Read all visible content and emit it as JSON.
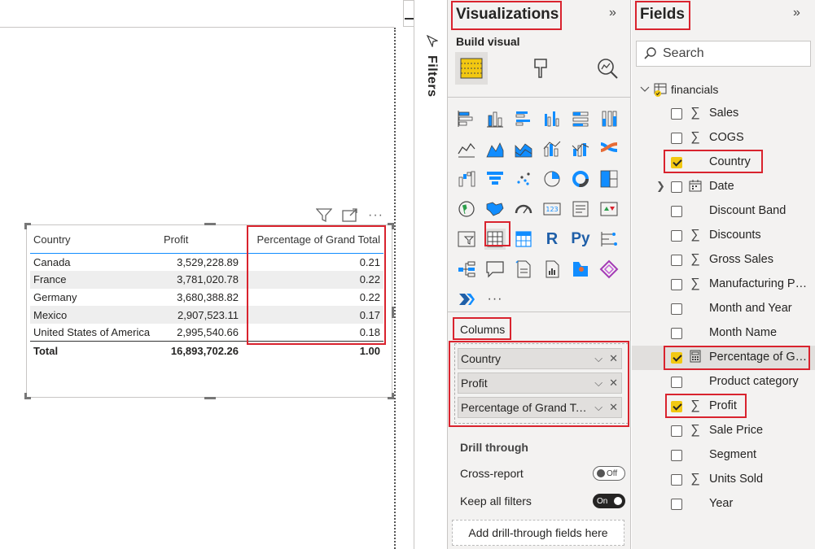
{
  "canvas": {
    "visual": {
      "columns": [
        "Country",
        "Profit",
        "Percentage of Grand Total"
      ],
      "rows": [
        [
          "Canada",
          "3,529,228.89",
          "0.21"
        ],
        [
          "France",
          "3,781,020.78",
          "0.22"
        ],
        [
          "Germany",
          "3,680,388.82",
          "0.22"
        ],
        [
          "Mexico",
          "2,907,523.11",
          "0.17"
        ],
        [
          "United States of America",
          "2,995,540.66",
          "0.18"
        ]
      ],
      "total": [
        "Total",
        "16,893,702.26",
        "1.00"
      ]
    }
  },
  "filters": {
    "label": "Filters"
  },
  "visualizations": {
    "title": "Visualizations",
    "expand_glyph": "»",
    "build_label": "Build visual",
    "r_glyph": "R",
    "py_glyph": "Py",
    "more_glyph": "···",
    "columns_label": "Columns",
    "columns": [
      {
        "label": "Country"
      },
      {
        "label": "Profit"
      },
      {
        "label": "Percentage of Grand Total"
      }
    ],
    "drill": {
      "title": "Drill through",
      "cross_report": "Cross-report",
      "cross_report_state": "Off",
      "keep_filters": "Keep all filters",
      "keep_filters_state": "On",
      "add_fields": "Add drill-through fields here"
    }
  },
  "fields": {
    "title": "Fields",
    "expand_glyph": "»",
    "search_placeholder": "Search",
    "table_name": "financials",
    "items": [
      {
        "name": "Sales",
        "type": "sigma",
        "checked": false
      },
      {
        "name": "COGS",
        "type": "sigma",
        "checked": false
      },
      {
        "name": "Country",
        "type": "",
        "checked": true
      },
      {
        "name": "Date",
        "type": "calendar",
        "checked": false,
        "expandable": true
      },
      {
        "name": "Discount Band",
        "type": "",
        "checked": false
      },
      {
        "name": "Discounts",
        "type": "sigma",
        "checked": false
      },
      {
        "name": "Gross Sales",
        "type": "sigma",
        "checked": false
      },
      {
        "name": "Manufacturing Price",
        "type": "sigma",
        "checked": false
      },
      {
        "name": "Month and Year",
        "type": "",
        "checked": false
      },
      {
        "name": "Month Name",
        "type": "",
        "checked": false
      },
      {
        "name": "Percentage of Grand Total",
        "type": "calculator",
        "checked": true,
        "selected": true
      },
      {
        "name": "Product category",
        "type": "",
        "checked": false
      },
      {
        "name": "Profit",
        "type": "sigma",
        "checked": true
      },
      {
        "name": "Sale Price",
        "type": "sigma",
        "checked": false
      },
      {
        "name": "Segment",
        "type": "",
        "checked": false
      },
      {
        "name": "Units Sold",
        "type": "sigma",
        "checked": false
      },
      {
        "name": "Year",
        "type": "",
        "checked": false
      }
    ]
  },
  "colors": {
    "accent": "#118dff",
    "highlight": "#d9232e",
    "check": "#f2c811"
  }
}
